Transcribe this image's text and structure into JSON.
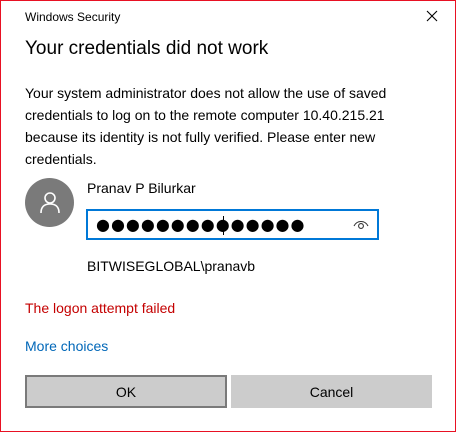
{
  "window": {
    "title": "Windows Security",
    "border_color": "#e81123"
  },
  "dialog": {
    "heading": "Your credentials did not work",
    "message": "Your system administrator does not allow the use of saved credentials to log on to the remote computer 10.40.215.21 because its identity is not fully verified. Please enter new credentials.",
    "user_name": "Pranav P Bilurkar",
    "password_masked": "●●●●●●●●●●●●●●",
    "domain_user": "BITWISEGLOBAL\\pranavb",
    "error_text": "The logon attempt failed",
    "more_choices": "More choices",
    "ok_label": "OK",
    "cancel_label": "Cancel"
  },
  "icons": {
    "close": "close-icon",
    "avatar": "user-avatar-icon",
    "reveal": "eye-reveal-icon"
  },
  "colors": {
    "accent": "#0078d7",
    "link": "#0067b8",
    "error": "#c40000",
    "avatar_bg": "#7a7a7a"
  }
}
